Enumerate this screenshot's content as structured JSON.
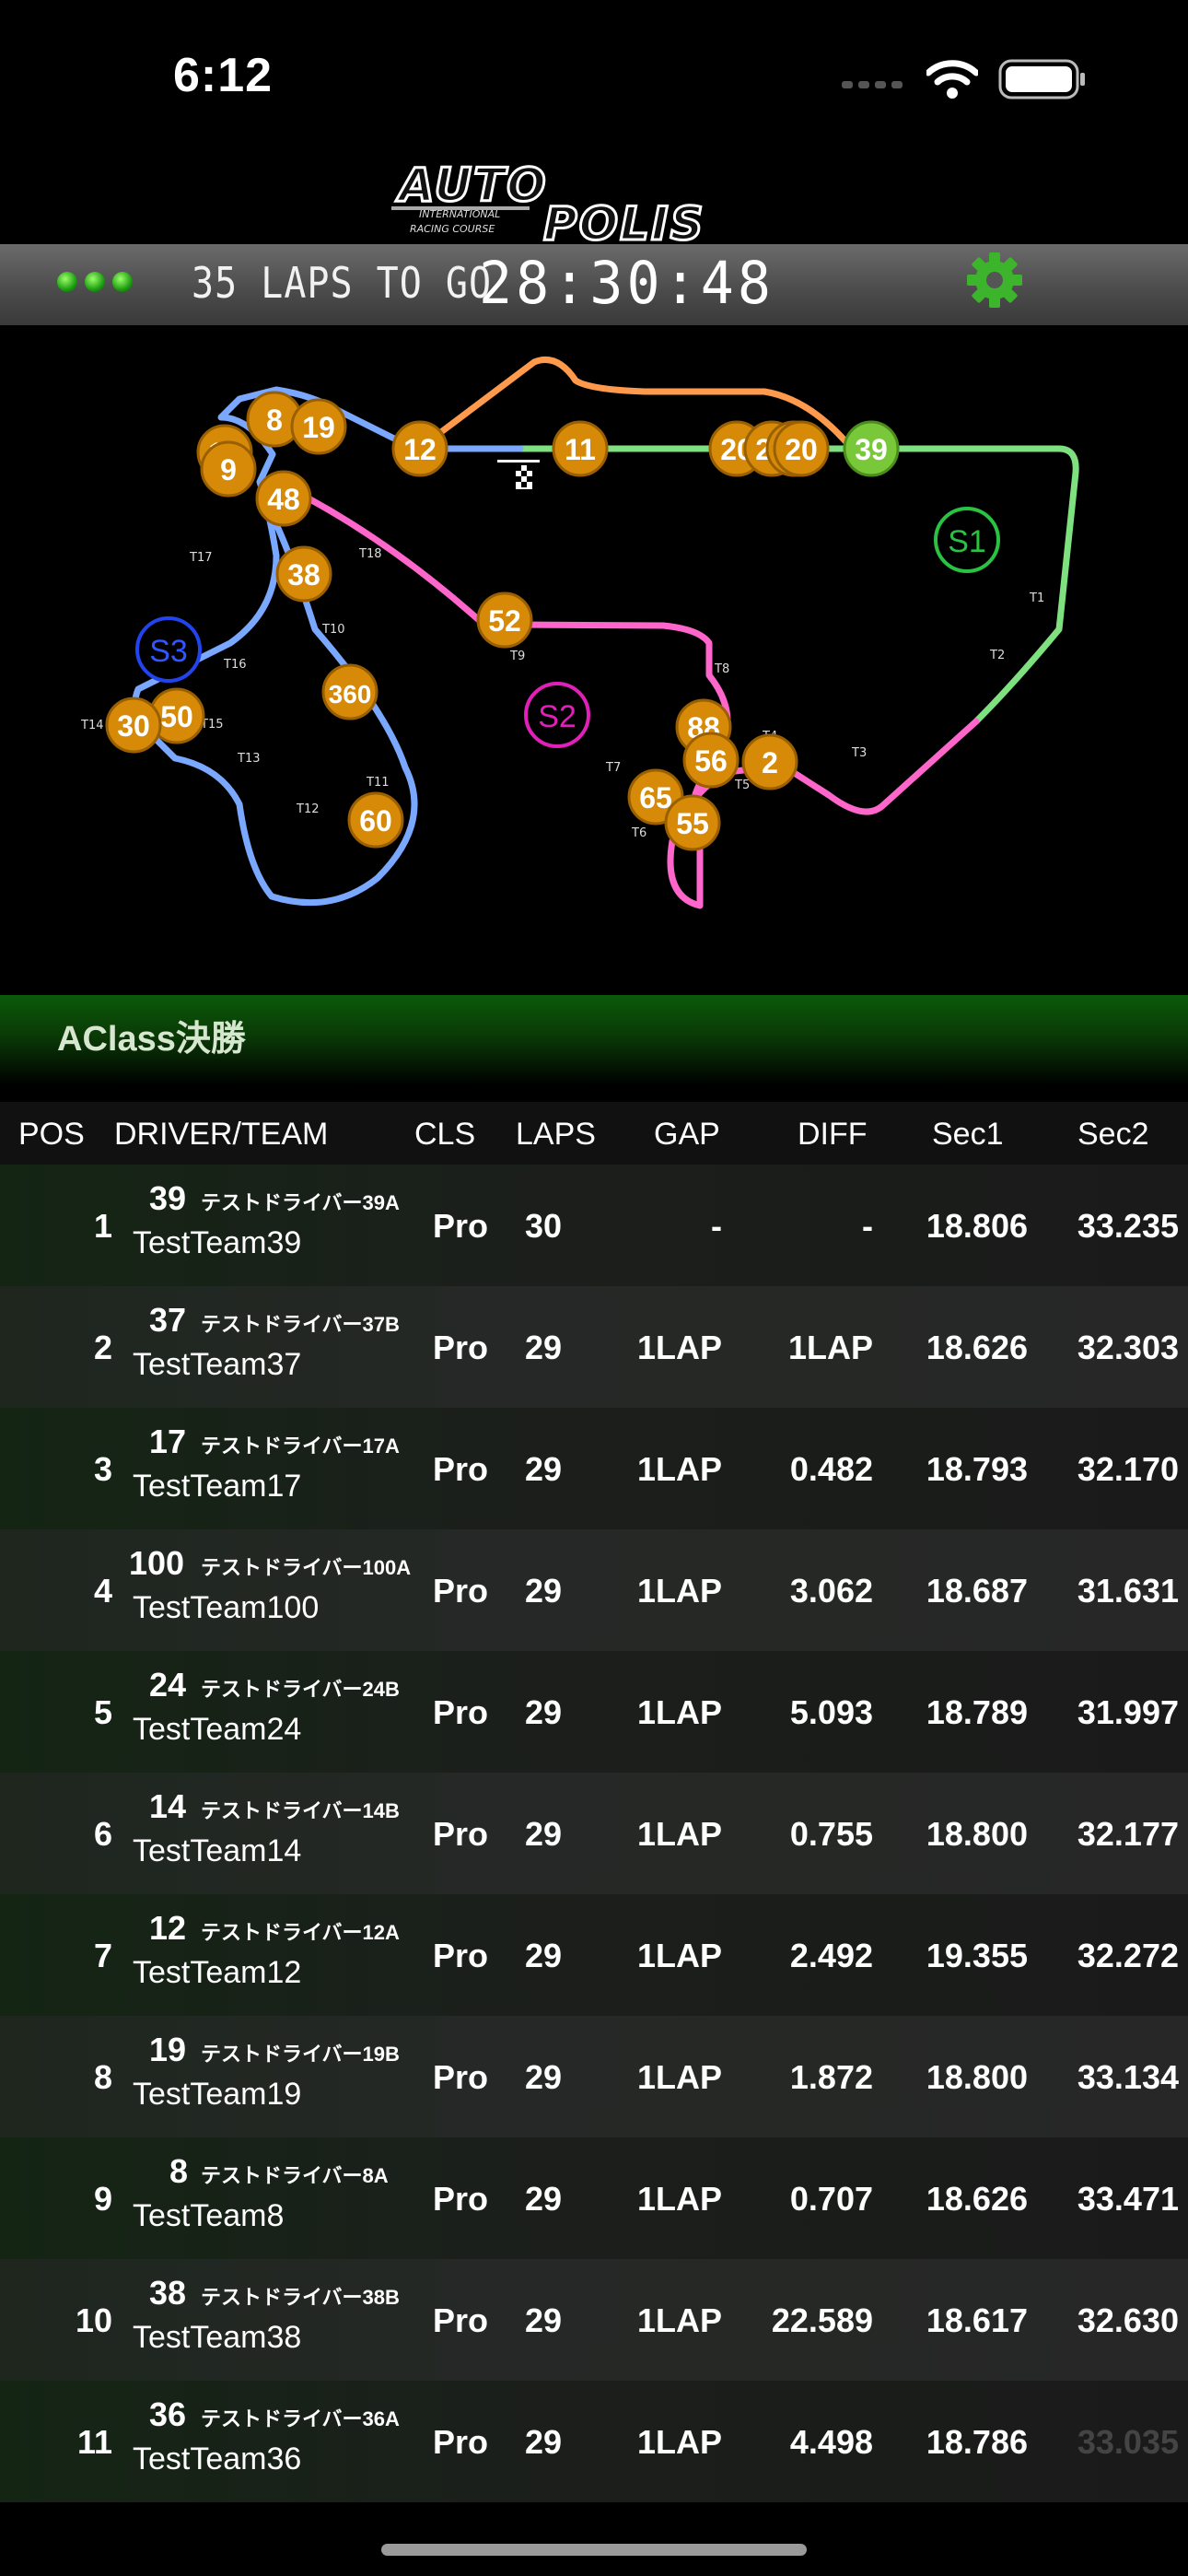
{
  "status_bar": {
    "time": "6:12"
  },
  "header": {
    "laps_to_go_label": "35 LAPS TO GO",
    "countdown": "28:30:48",
    "colors": {
      "light": "#22cc11",
      "gear": "#3cb52c"
    }
  },
  "map": {
    "sector_labels": [
      "S1",
      "S2",
      "S3"
    ],
    "turn_labels": [
      "T1",
      "T2",
      "T3",
      "T4",
      "T5",
      "T6",
      "T7",
      "T8",
      "T9",
      "T10",
      "T11",
      "T12",
      "T13",
      "T14",
      "T15",
      "T16",
      "T17",
      "T18"
    ],
    "car_markers": [
      "8",
      "19",
      "12",
      "11",
      "20",
      "39",
      "10",
      "9",
      "48",
      "38",
      "52",
      "360",
      "50",
      "30",
      "88",
      "2",
      "56",
      "65",
      "55",
      "60"
    ]
  },
  "race": {
    "class_title": "AClass決勝"
  },
  "table": {
    "headers": {
      "pos": "POS",
      "driver": "DRIVER/TEAM",
      "cls": "CLS",
      "laps": "LAPS",
      "gap": "GAP",
      "diff": "DIFF",
      "sec1": "Sec1",
      "sec2": "Sec2"
    },
    "rows": [
      {
        "pos": "1",
        "num": "39",
        "driver": "テストドライバー39A",
        "team": "TestTeam39",
        "cls": "Pro",
        "laps": "30",
        "gap": "-",
        "diff": "-",
        "sec1": "18.806",
        "sec2": "33.235"
      },
      {
        "pos": "2",
        "num": "37",
        "driver": "テストドライバー37B",
        "team": "TestTeam37",
        "cls": "Pro",
        "laps": "29",
        "gap": "1LAP",
        "diff": "1LAP",
        "sec1": "18.626",
        "sec2": "32.303"
      },
      {
        "pos": "3",
        "num": "17",
        "driver": "テストドライバー17A",
        "team": "TestTeam17",
        "cls": "Pro",
        "laps": "29",
        "gap": "1LAP",
        "diff": "0.482",
        "sec1": "18.793",
        "sec2": "32.170"
      },
      {
        "pos": "4",
        "num": "100",
        "driver": "テストドライバー100A",
        "team": "TestTeam100",
        "cls": "Pro",
        "laps": "29",
        "gap": "1LAP",
        "diff": "3.062",
        "sec1": "18.687",
        "sec2": "31.631"
      },
      {
        "pos": "5",
        "num": "24",
        "driver": "テストドライバー24B",
        "team": "TestTeam24",
        "cls": "Pro",
        "laps": "29",
        "gap": "1LAP",
        "diff": "5.093",
        "sec1": "18.789",
        "sec2": "31.997"
      },
      {
        "pos": "6",
        "num": "14",
        "driver": "テストドライバー14B",
        "team": "TestTeam14",
        "cls": "Pro",
        "laps": "29",
        "gap": "1LAP",
        "diff": "0.755",
        "sec1": "18.800",
        "sec2": "32.177"
      },
      {
        "pos": "7",
        "num": "12",
        "driver": "テストドライバー12A",
        "team": "TestTeam12",
        "cls": "Pro",
        "laps": "29",
        "gap": "1LAP",
        "diff": "2.492",
        "sec1": "19.355",
        "sec2": "32.272"
      },
      {
        "pos": "8",
        "num": "19",
        "driver": "テストドライバー19B",
        "team": "TestTeam19",
        "cls": "Pro",
        "laps": "29",
        "gap": "1LAP",
        "diff": "1.872",
        "sec1": "18.800",
        "sec2": "33.134"
      },
      {
        "pos": "9",
        "num": "8",
        "driver": "テストドライバー8A",
        "team": "TestTeam8",
        "cls": "Pro",
        "laps": "29",
        "gap": "1LAP",
        "diff": "0.707",
        "sec1": "18.626",
        "sec2": "33.471"
      },
      {
        "pos": "10",
        "num": "38",
        "driver": "テストドライバー38B",
        "team": "TestTeam38",
        "cls": "Pro",
        "laps": "29",
        "gap": "1LAP",
        "diff": "22.589",
        "sec1": "18.617",
        "sec2": "32.630"
      },
      {
        "pos": "11",
        "num": "36",
        "driver": "テストドライバー36A",
        "team": "TestTeam36",
        "cls": "Pro",
        "laps": "29",
        "gap": "1LAP",
        "diff": "4.498",
        "sec1": "18.786",
        "sec2": "33.035"
      }
    ]
  }
}
